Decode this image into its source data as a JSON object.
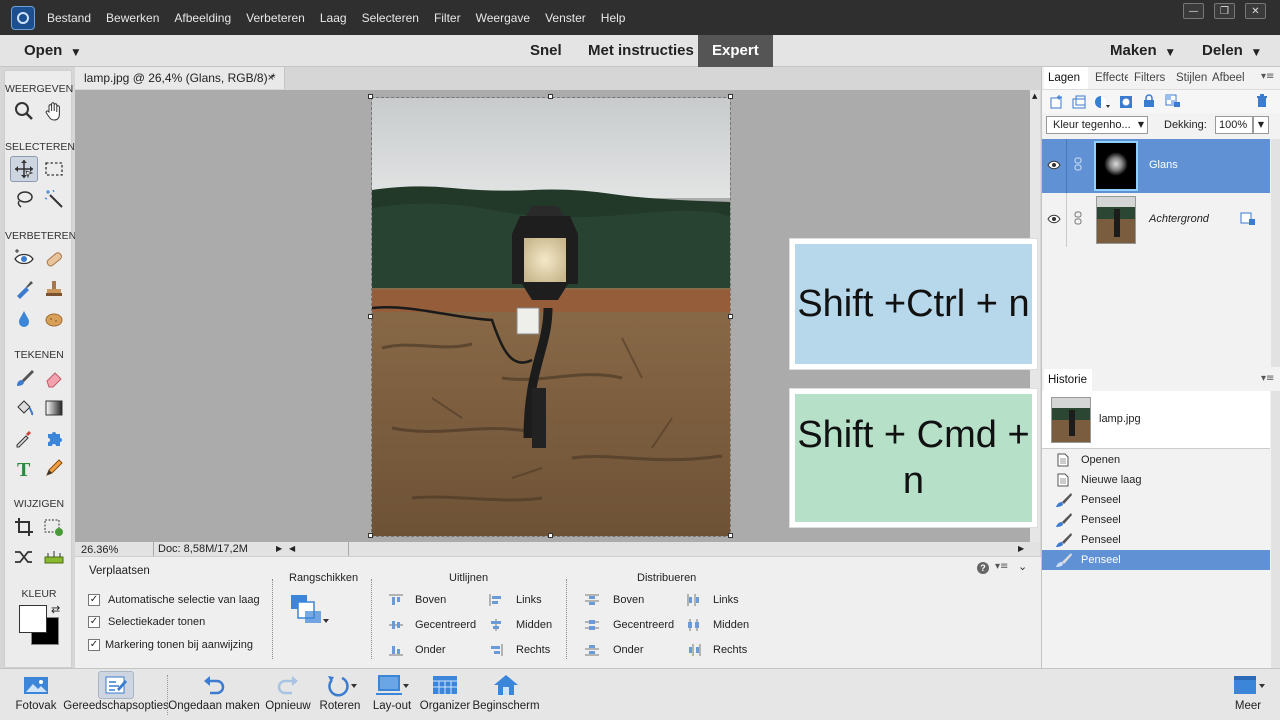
{
  "menu": [
    "Bestand",
    "Bewerken",
    "Afbeelding",
    "Verbeteren",
    "Laag",
    "Selecteren",
    "Filter",
    "Weergave",
    "Venster",
    "Help"
  ],
  "modebar": {
    "open": "Open",
    "snel": "Snel",
    "instructies": "Met instructies",
    "expert": "Expert",
    "maken": "Maken",
    "delen": "Delen"
  },
  "toolbox": {
    "weergeven": "WEERGEVEN",
    "selecteren": "SELECTEREN",
    "verbeteren": "VERBETEREN",
    "tekenen": "TEKENEN",
    "wijzigen": "WIJZIGEN",
    "kleur": "KLEUR"
  },
  "document": {
    "tab_title": "lamp.jpg @ 26,4% (Glans, RGB/8) *",
    "close": "×",
    "zoom": "26.36%",
    "doc_size": "Doc: 8,58M/17,2M"
  },
  "options": {
    "tool_name": "Verplaatsen",
    "checks": [
      "Automatische selectie van laag",
      "Selectiekader tonen",
      "Markering tonen bij aanwijzing"
    ],
    "rangschikken": "Rangschikken",
    "uitlijnen": "Uitlijnen",
    "uitlijnen_items": [
      "Boven",
      "Gecentreerd",
      "Onder",
      "Links",
      "Midden",
      "Rechts"
    ],
    "distribueren": "Distribueren",
    "distribueren_items": [
      "Boven",
      "Gecentreerd",
      "Onder",
      "Links",
      "Midden",
      "Rechts"
    ]
  },
  "layers_panel": {
    "tabs": [
      "Lagen",
      "Effecten",
      "Filters",
      "Stijlen",
      "Afbeeldingen"
    ],
    "blend_mode": "Kleur tegenho...",
    "opacity_label": "Dekking:",
    "opacity_value": "100%",
    "layers": [
      {
        "name": "Glans",
        "selected": true
      },
      {
        "name": "Achtergrond",
        "selected": false
      }
    ]
  },
  "history_panel": {
    "title": "Historie",
    "snapshot": "lamp.jpg",
    "items": [
      "Openen",
      "Nieuwe laag",
      "Penseel",
      "Penseel",
      "Penseel",
      "Penseel"
    ]
  },
  "bottombar": {
    "fotovak": "Fotovak",
    "gereedschapsopties": "Gereedschapsopties",
    "ongedaan": "Ongedaan maken",
    "opnieuw": "Opnieuw",
    "roteren": "Roteren",
    "layout": "Lay-out",
    "organizer": "Organizer",
    "beginscherm": "Beginscherm",
    "meer": "Meer"
  },
  "overlays": {
    "windows_shortcut": "Shift +Ctrl + n",
    "mac_shortcut": "Shift + Cmd + n"
  },
  "colors": {
    "accent": "#5b8fd0",
    "selection": "#5f91d4",
    "expert_bg": "#555555",
    "windows_box": "#b7d7ea",
    "mac_box": "#b7e0c8"
  }
}
